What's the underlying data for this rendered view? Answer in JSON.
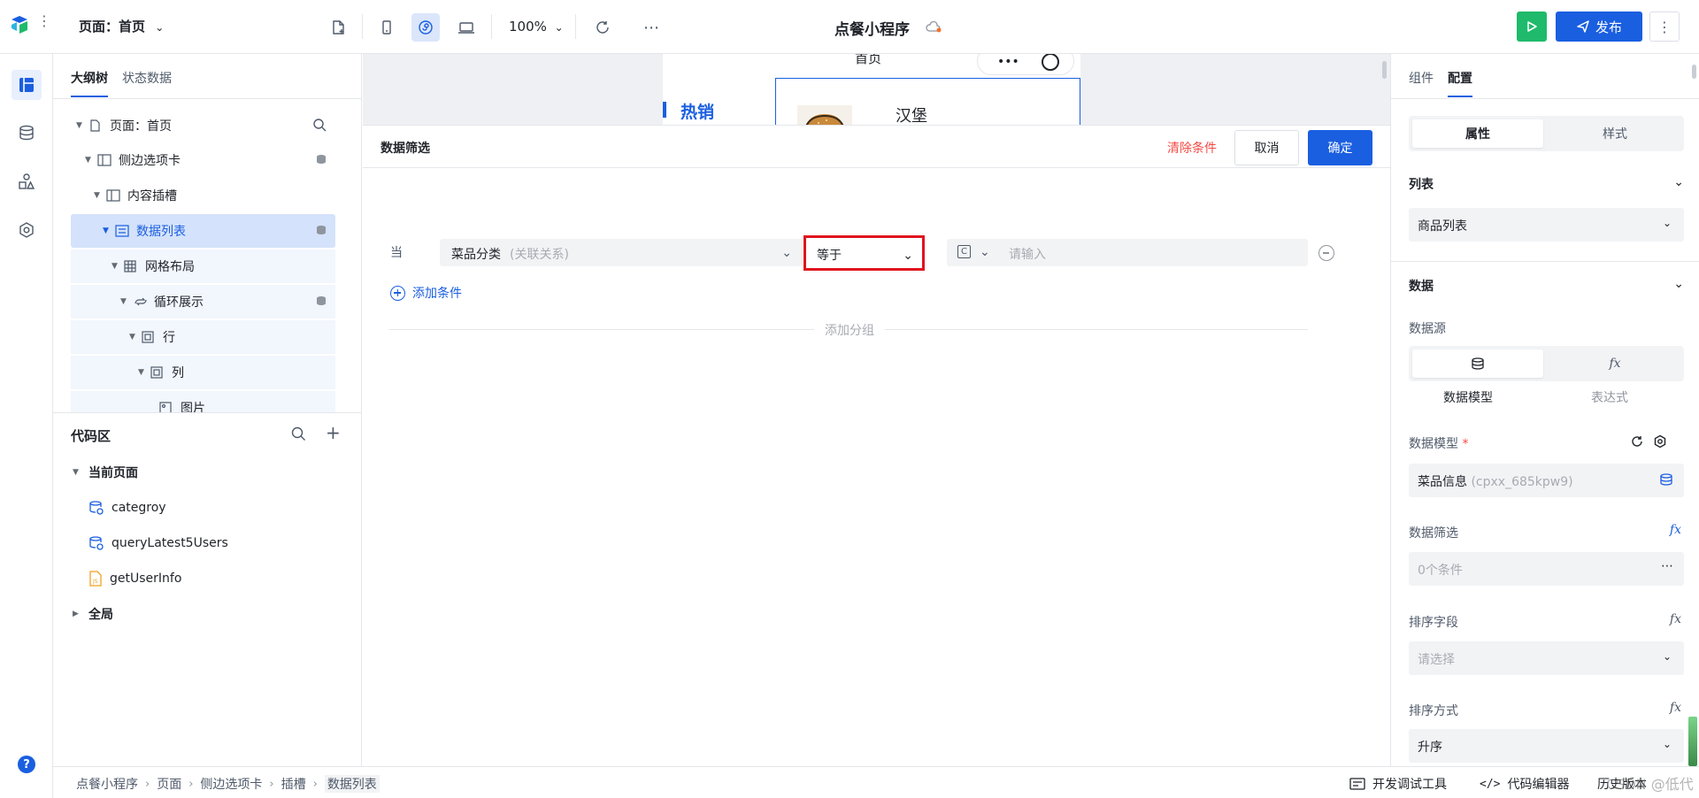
{
  "topbar": {
    "page_select": "页面：首页",
    "zoom": "100%",
    "app_title": "点餐小程序",
    "publish_label": "发布"
  },
  "outline": {
    "tabs": [
      "大纲树",
      "状态数据"
    ],
    "tree": [
      {
        "label": "页面：首页",
        "icon": "page-icon"
      },
      {
        "label": "侧边选项卡",
        "icon": "layout-icon"
      },
      {
        "label": "内容插槽",
        "icon": "layout-icon"
      },
      {
        "label": "数据列表",
        "icon": "list-icon"
      },
      {
        "label": "网格布局",
        "icon": "grid-icon"
      },
      {
        "label": "循环展示",
        "icon": "loop-icon"
      },
      {
        "label": "行",
        "icon": "frame-icon"
      },
      {
        "label": "列",
        "icon": "frame-icon"
      },
      {
        "label": "图片",
        "icon": "image-icon"
      }
    ]
  },
  "code_area": {
    "title": "代码区",
    "current_page": "当前页面",
    "items": [
      "categroy",
      "queryLatest5Users",
      "getUserInfo"
    ],
    "global": "全局"
  },
  "canvas": {
    "phone_home": "首页",
    "hot_label": "热销",
    "product_name": "汉堡"
  },
  "filter_dialog": {
    "title": "数据筛选",
    "clear": "清除条件",
    "cancel": "取消",
    "confirm": "确定",
    "when": "当",
    "field_value": "菜品分类",
    "field_hint": "(关联关系)",
    "operator": "等于",
    "value_type": "C",
    "value_placeholder": "请输入",
    "add_condition": "添加条件",
    "add_group": "添加分组"
  },
  "right_panel": {
    "tabs": [
      "组件",
      "配置"
    ],
    "seg": [
      "属性",
      "样式"
    ],
    "list_section": "列表",
    "list_value": "商品列表",
    "data_section": "数据",
    "datasource_label": "数据源",
    "datasource_options": [
      "数据模型",
      "表达式"
    ],
    "model_label": "数据模型",
    "model_required": "*",
    "model_value": "菜品信息",
    "model_id": "(cpxx_685kpw9)",
    "filter_label": "数据筛选",
    "filter_value": "0个条件",
    "sort_field_label": "排序字段",
    "sort_field_placeholder": "请选择",
    "sort_order_label": "排序方式",
    "sort_order_value": "升序",
    "fx": "fx"
  },
  "bottombar": {
    "breadcrumb": [
      "点餐小程序",
      "页面",
      "侧边选项卡",
      "插槽",
      "数据列表"
    ],
    "devtools": "开发调试工具",
    "code_editor": "代码编辑器",
    "history": "历史版本",
    "watermark": "CSDN @低代码布道师"
  },
  "colors": {
    "accent": "#1a5fe0",
    "run_green": "#1fba6b",
    "danger": "#f54a45",
    "highlight_box": "#e0141e"
  }
}
